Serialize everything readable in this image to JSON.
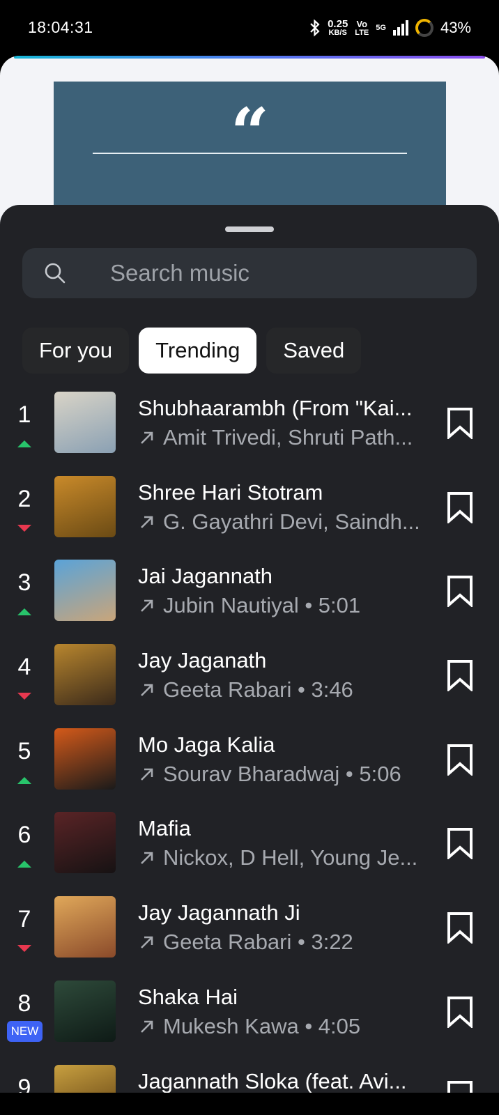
{
  "status_bar": {
    "time": "18:04:31",
    "net_speed": "0.25",
    "net_unit": "KB/S",
    "volte_top": "Vo",
    "volte_bottom": "LTE",
    "network": "5G",
    "battery": "43%"
  },
  "search": {
    "placeholder": "Search music"
  },
  "tabs": [
    {
      "label": "For you",
      "active": false
    },
    {
      "label": "Trending",
      "active": true
    },
    {
      "label": "Saved",
      "active": false
    }
  ],
  "tracks": [
    {
      "rank": "1",
      "trend": "up",
      "title": "Shubhaarambh (From \"Kai...",
      "subtitle": "Amit Trivedi, Shruti Path...",
      "art_colors": [
        "#d9d4c7",
        "#8aa0b3"
      ]
    },
    {
      "rank": "2",
      "trend": "down",
      "title": "Shree Hari Stotram",
      "subtitle": "G. Gayathri Devi, Saindh...",
      "art_colors": [
        "#c98a2a",
        "#6a4a14"
      ]
    },
    {
      "rank": "3",
      "trend": "up",
      "title": "Jai Jagannath",
      "subtitle": "Jubin Nautiyal • 5:01",
      "art_colors": [
        "#5aa3d8",
        "#c9a57a"
      ]
    },
    {
      "rank": "4",
      "trend": "down",
      "title": "Jay Jaganath",
      "subtitle": "Geeta Rabari • 3:46",
      "art_colors": [
        "#b8862e",
        "#3b2a1a"
      ]
    },
    {
      "rank": "5",
      "trend": "up",
      "title": "Mo Jaga Kalia",
      "subtitle": "Sourav Bharadwaj • 5:06",
      "art_colors": [
        "#d45a1a",
        "#1a1a1a"
      ]
    },
    {
      "rank": "6",
      "trend": "up",
      "title": "Mafia",
      "subtitle": "Nickox, D Hell, Young Je...",
      "art_colors": [
        "#5a2426",
        "#161213"
      ]
    },
    {
      "rank": "7",
      "trend": "down",
      "title": "Jay Jagannath Ji",
      "subtitle": "Geeta Rabari • 3:22",
      "art_colors": [
        "#e0a85a",
        "#8a4a2a"
      ]
    },
    {
      "rank": "8",
      "trend": "new",
      "badge": "NEW",
      "title": "Shaka Hai",
      "subtitle": "Mukesh Kawa • 4:05",
      "art_colors": [
        "#2e4a3a",
        "#0e1a16"
      ]
    },
    {
      "rank": "9",
      "trend": "none",
      "title": "Jagannath Sloka (feat. Avi...",
      "subtitle": "",
      "art_colors": [
        "#c8a040",
        "#5a3a10"
      ]
    }
  ]
}
